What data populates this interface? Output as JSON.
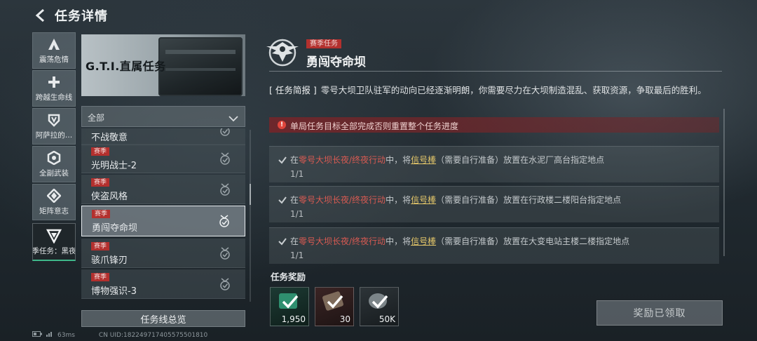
{
  "header": {
    "title": "任务详情"
  },
  "rail": [
    {
      "label": "震荡危情",
      "icon": "letter-a-icon",
      "active": false
    },
    {
      "label": "跨越生命线",
      "icon": "cross-icon",
      "active": false
    },
    {
      "label": "阿萨拉的…",
      "icon": "shield-v-icon",
      "active": false
    },
    {
      "label": "全副武装",
      "icon": "hex-swirl-icon",
      "active": false
    },
    {
      "label": "矩阵意志",
      "icon": "diamond-arrows-icon",
      "active": false
    },
    {
      "label": "季任务：黑夜",
      "icon": "inverted-triangle-icon",
      "active": true
    }
  ],
  "banner": {
    "title": "G.T.I.直属任务"
  },
  "filter": {
    "value": "全部"
  },
  "missions": [
    {
      "tag": "",
      "name": "不战敬意",
      "selected": false
    },
    {
      "tag": "赛季",
      "name": "光明战士-2",
      "selected": false
    },
    {
      "tag": "赛季",
      "name": "侠盗风格",
      "selected": false
    },
    {
      "tag": "赛季",
      "name": "勇闯夺命坝",
      "selected": true
    },
    {
      "tag": "赛季",
      "name": "骇爪锋刃",
      "selected": false
    },
    {
      "tag": "赛季",
      "name": "博物强识-3",
      "selected": false
    }
  ],
  "summary_button": "任务线总览",
  "status_bar": {
    "ping": "63ms",
    "uid": "CN UID:182249717405575501810"
  },
  "detail": {
    "season_tag": "赛季任务",
    "title": "勇闯夺命坝",
    "brief_label": "[ 任务简报 ]",
    "brief_text": "零号大坝卫队驻军的动向已经逐渐明朗，你需要尽力在大坝制造混乱、获取资源，争取最后的胜利。",
    "warning": "单局任务目标全部完成否则重置整个任务进度",
    "objectives": [
      {
        "pre": "在",
        "mode": "零号大坝长夜/终夜行动",
        "mid": "中，将",
        "item": "信号棒",
        "post": "（需要自行准备）放置在水泥厂高台指定地点",
        "progress": "1/1"
      },
      {
        "pre": "在",
        "mode": "零号大坝长夜/终夜行动",
        "mid": "中，将",
        "item": "信号棒",
        "post": "（需要自行准备）放置在行政楼二楼阳台指定地点",
        "progress": "1/1"
      },
      {
        "pre": "在",
        "mode": "零号大坝长夜/终夜行动",
        "mid": "中，将",
        "item": "信号棒",
        "post": "（需要自行准备）放置在大变电站主楼二楼指定地点",
        "progress": "1/1"
      }
    ],
    "reward_label": "任务奖励",
    "rewards": [
      {
        "count": "1,950",
        "icon": "green-voucher-icon"
      },
      {
        "count": "30",
        "icon": "ticket-bundle-icon"
      },
      {
        "count": "50K",
        "icon": "coin-icon"
      }
    ],
    "claimed_button": "奖励已领取"
  },
  "colors": {
    "accent_green": "#3fb88a",
    "season_red": "#b3302e",
    "warn_red": "#e0453c",
    "link_gold": "#e6c86a"
  }
}
